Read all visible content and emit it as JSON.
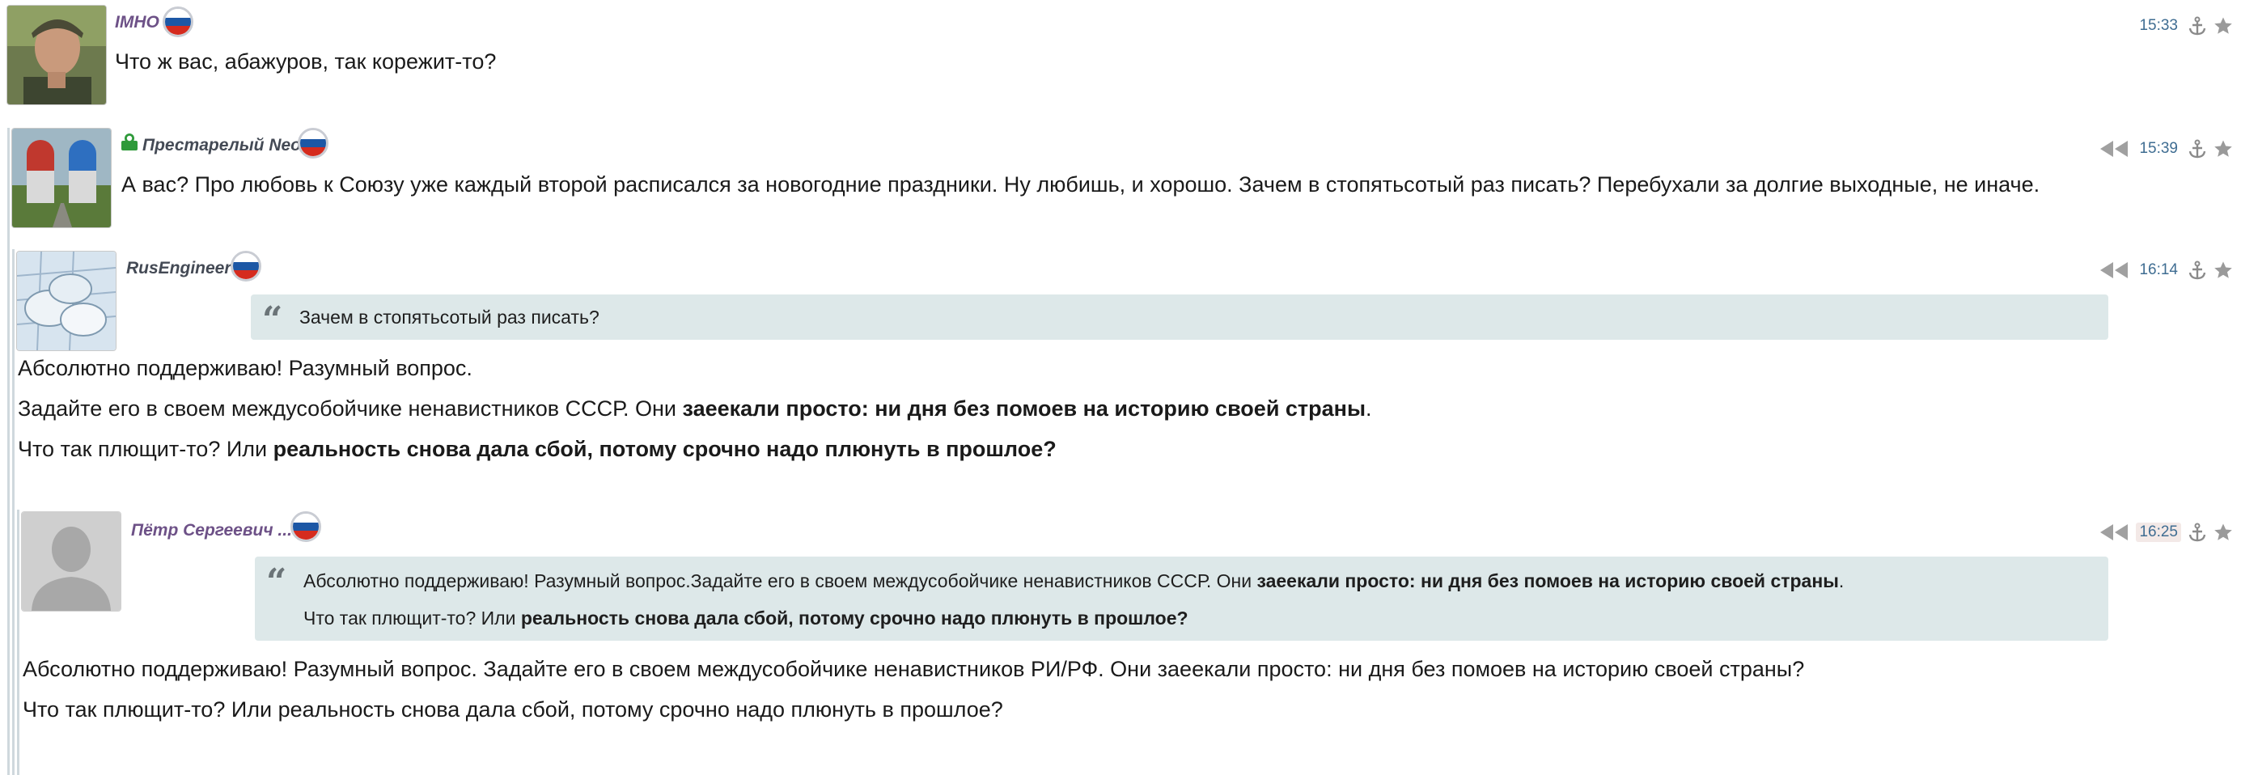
{
  "comments": [
    {
      "author": "IMHO",
      "time": "15:33",
      "paragraphs": [
        [
          {
            "t": "Что ж вас, абажуров, так корежит-то?",
            "b": false
          }
        ]
      ]
    },
    {
      "author": "Престарелый Neo",
      "time": "15:39",
      "paragraphs": [
        [
          {
            "t": "А вас? Про любовь к Союзу уже каждый второй расписался за новогодние праздники. Ну любишь, и хорошо. Зачем в стопятьсотый раз писать? Перебухали за долгие выходные, не иначе.",
            "b": false
          }
        ]
      ]
    },
    {
      "author": "RusEngineer",
      "time": "16:14",
      "quote": [
        [
          {
            "t": "Зачем в стопятьсотый раз писать?",
            "b": false
          }
        ]
      ],
      "paragraphs": [
        [
          {
            "t": "Абсолютно поддерживаю! Разумный вопрос.",
            "b": false
          }
        ],
        [
          {
            "t": "Задайте его в своем междусобойчике ненавистников СССР. Они ",
            "b": false
          },
          {
            "t": "заеекали просто: ни дня без помоев на историю своей страны",
            "b": true
          },
          {
            "t": ".",
            "b": false
          }
        ],
        [
          {
            "t": "Что так плющит-то? Или ",
            "b": false
          },
          {
            "t": "реальность снова дала сбой, потому срочно надо плюнуть в прошлое?",
            "b": true
          }
        ]
      ]
    },
    {
      "author": "Пётр Сергеевич ...",
      "time": "16:25",
      "quote": [
        [
          {
            "t": "Абсолютно поддерживаю! Разумный вопрос.Задайте его в своем междусобойчике ненавистников СССР. Они ",
            "b": false
          },
          {
            "t": "заеекали просто: ни дня без помоев на историю своей страны",
            "b": true
          },
          {
            "t": ".",
            "b": false
          }
        ],
        [
          {
            "t": "Что так плющит-то? Или ",
            "b": false
          },
          {
            "t": "реальность снова дала сбой, потому срочно надо плюнуть в прошлое?",
            "b": true
          }
        ]
      ],
      "paragraphs": [
        [
          {
            "t": "Абсолютно поддерживаю! Разумный вопрос. Задайте его в своем междусобойчике ненавистников РИ/РФ. Они заеекали просто: ни дня без помоев на историю своей страны?",
            "b": false
          }
        ],
        [
          {
            "t": "Что так плющит-то? Или реальность снова дала сбой, потому срочно надо плюнуть в прошлое?",
            "b": false
          }
        ]
      ]
    }
  ],
  "icons": {
    "flag": "russia-flag-icon",
    "reply_to_parent": "back-arrow-icon",
    "permalink": "anchor-icon",
    "favorite": "star-icon",
    "user_badge": "user-badge-icon"
  },
  "colors": {
    "author": "#6d5187",
    "time": "#3f6d92",
    "quote_bg": "#dde8e9",
    "thread_line": "#cfd8dd"
  }
}
